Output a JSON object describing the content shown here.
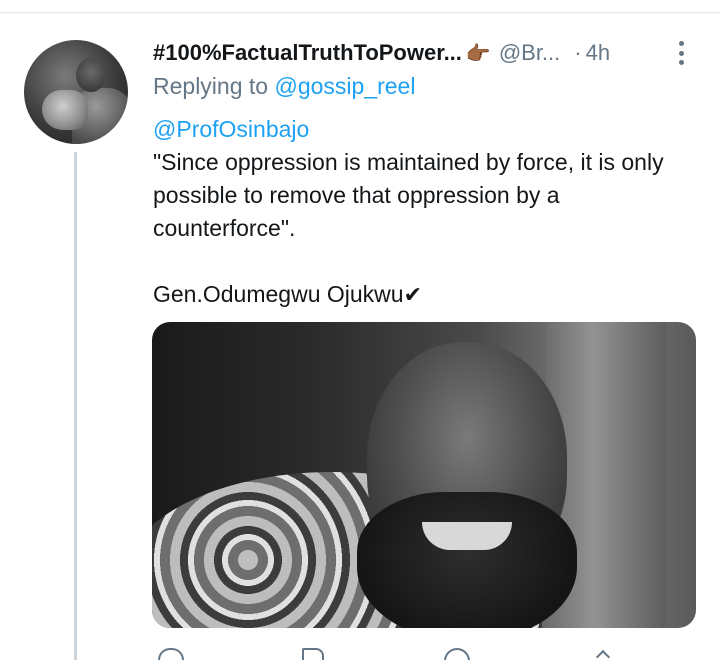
{
  "tweet": {
    "display_name": "#100%FactualTruthToPower...",
    "emoji": "👉🏾",
    "handle": "@Br...",
    "separator": "·",
    "time": "4h",
    "replying_prefix": "Replying to",
    "replying_to": "@gossip_reel",
    "mention": "@ProfOsinbajo",
    "text_line1": "\"Since oppression is maintained by force, it is only possible to remove that oppression by a counterforce\".",
    "attribution": "Gen.Odumegwu Ojukwu",
    "check": "✔"
  },
  "icons": {
    "more": "more-vertical-icon",
    "reply": "reply-icon",
    "retweet": "retweet-icon",
    "like": "heart-icon",
    "share": "share-icon"
  },
  "colors": {
    "link": "#1da1f2",
    "muted": "#657786",
    "text": "#14171a",
    "thread_line": "#cdd5dc"
  }
}
